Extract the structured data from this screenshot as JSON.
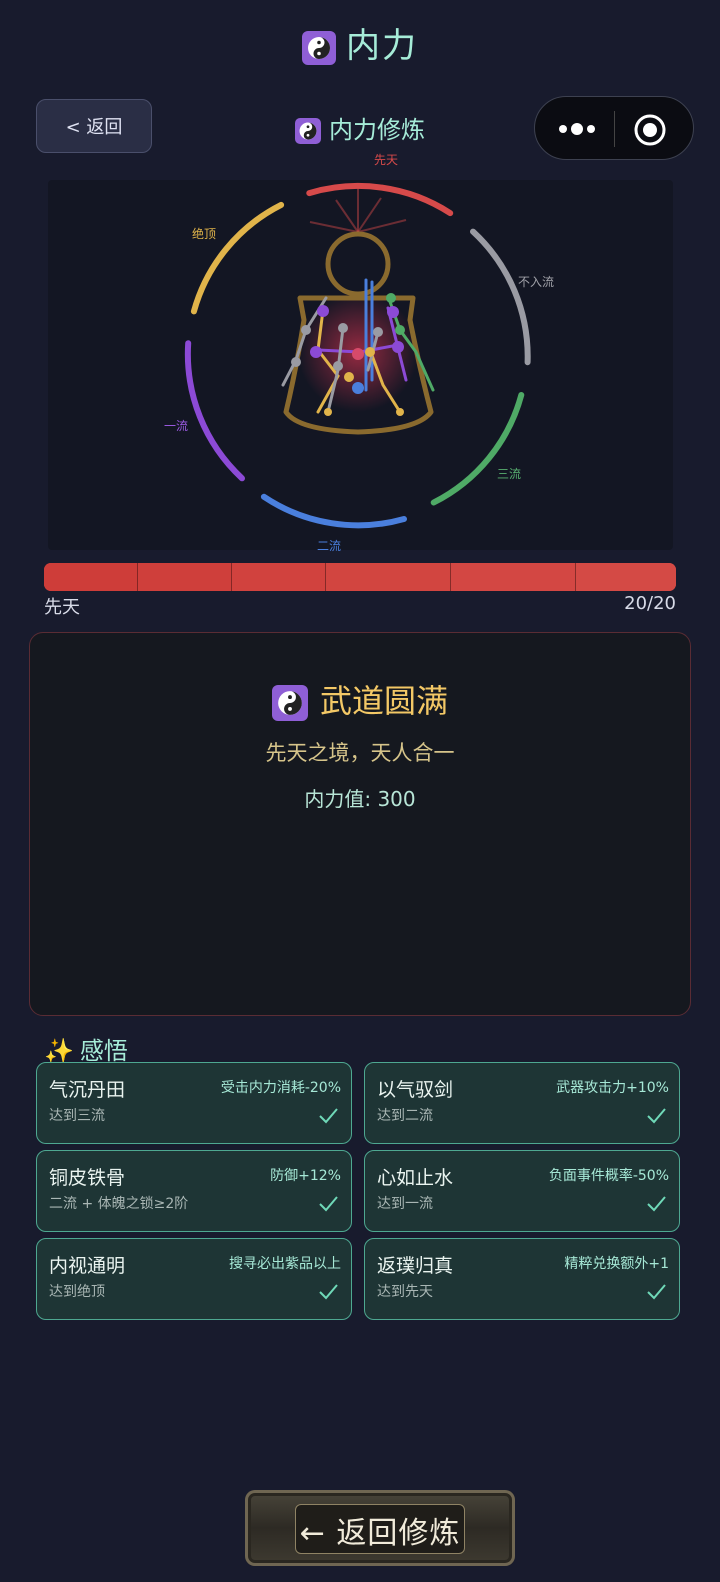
{
  "header": {
    "title": "内力",
    "icon": "taiji-icon"
  },
  "nav": {
    "back_label": "< 返回",
    "subtitle": "内力修炼"
  },
  "ring": {
    "labels": {
      "xiantian": "先天",
      "burulu": "不入流",
      "sanliu": "三流",
      "erliu": "二流",
      "yiliu": "一流",
      "jueding": "绝顶"
    },
    "colors": {
      "xiantian": "#d64a4a",
      "burulu": "#9a9ba3",
      "sanliu": "#4faa66",
      "erliu": "#4a7fdd",
      "yiliu": "#8c4ad6",
      "jueding": "#e1b44a"
    }
  },
  "progress": {
    "rank": "先天",
    "value_text": "20/20",
    "fraction": 1.0,
    "segments": 6,
    "color": "#d44a45"
  },
  "status": {
    "title": "武道圆满",
    "subtitle": "先天之境，天人合一",
    "value_line": "内力值: 300"
  },
  "insights": {
    "header": "感悟",
    "items": [
      {
        "name": "气沉丹田",
        "effect": "受击内力消耗-20%",
        "req": "达到三流"
      },
      {
        "name": "以气驭剑",
        "effect": "武器攻击力+10%",
        "req": "达到二流"
      },
      {
        "name": "铜皮铁骨",
        "effect": "防御+12%",
        "req": "二流 + 体魄之锁≥2阶"
      },
      {
        "name": "心如止水",
        "effect": "负面事件概率-50%",
        "req": "达到一流"
      },
      {
        "name": "内视通明",
        "effect": "搜寻必出紫品以上",
        "req": "达到绝顶"
      },
      {
        "name": "返璞归真",
        "effect": "精粹兑换额外+1",
        "req": "达到先天"
      }
    ]
  },
  "footer": {
    "return_label": "← 返回修炼"
  }
}
